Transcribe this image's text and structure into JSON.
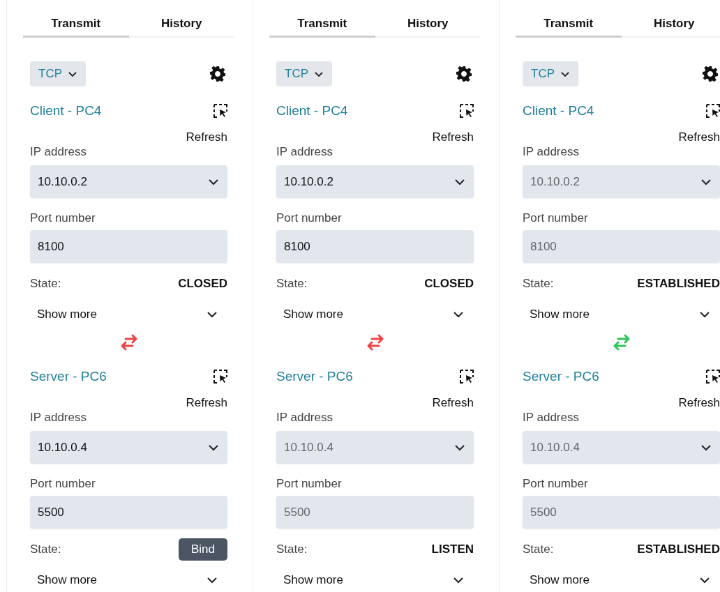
{
  "panels": [
    {
      "tabs": [
        {
          "label": "Transmit",
          "selected": true
        },
        {
          "label": "History",
          "selected": false
        }
      ],
      "protocol": "TCP",
      "connected": false,
      "endpoints": [
        {
          "title": "Client - PC4",
          "refresh": "Refresh",
          "ip_label": "IP address",
          "ip_value": "10.10.0.2",
          "ip_disabled": false,
          "port_label": "Port number",
          "port_value": "8100",
          "port_disabled": false,
          "state_label": "State:",
          "state": {
            "kind": "text",
            "text": "CLOSED"
          },
          "show_more": "Show more"
        },
        {
          "title": "Server - PC6",
          "refresh": "Refresh",
          "ip_label": "IP address",
          "ip_value": "10.10.0.4",
          "ip_disabled": false,
          "port_label": "Port number",
          "port_value": "5500",
          "port_disabled": false,
          "state_label": "State:",
          "state": {
            "kind": "button",
            "text": "Bind"
          },
          "show_more": "Show more"
        }
      ]
    },
    {
      "tabs": [
        {
          "label": "Transmit",
          "selected": true
        },
        {
          "label": "History",
          "selected": false
        }
      ],
      "protocol": "TCP",
      "connected": false,
      "endpoints": [
        {
          "title": "Client - PC4",
          "refresh": "Refresh",
          "ip_label": "IP address",
          "ip_value": "10.10.0.2",
          "ip_disabled": false,
          "port_label": "Port number",
          "port_value": "8100",
          "port_disabled": false,
          "state_label": "State:",
          "state": {
            "kind": "text",
            "text": "CLOSED"
          },
          "show_more": "Show more"
        },
        {
          "title": "Server - PC6",
          "refresh": "Refresh",
          "ip_label": "IP address",
          "ip_value": "10.10.0.4",
          "ip_disabled": true,
          "port_label": "Port number",
          "port_value": "5500",
          "port_disabled": true,
          "state_label": "State:",
          "state": {
            "kind": "text",
            "text": "LISTEN"
          },
          "show_more": "Show more"
        }
      ]
    },
    {
      "tabs": [
        {
          "label": "Transmit",
          "selected": true
        },
        {
          "label": "History",
          "selected": false
        }
      ],
      "protocol": "TCP",
      "connected": true,
      "endpoints": [
        {
          "title": "Client - PC4",
          "refresh": "Refresh",
          "ip_label": "IP address",
          "ip_value": "10.10.0.2",
          "ip_disabled": true,
          "port_label": "Port number",
          "port_value": "8100",
          "port_disabled": true,
          "state_label": "State:",
          "state": {
            "kind": "text",
            "text": "ESTABLISHED"
          },
          "show_more": "Show more"
        },
        {
          "title": "Server - PC6",
          "refresh": "Refresh",
          "ip_label": "IP address",
          "ip_value": "10.10.0.4",
          "ip_disabled": true,
          "port_label": "Port number",
          "port_value": "5500",
          "port_disabled": true,
          "state_label": "State:",
          "state": {
            "kind": "text",
            "text": "ESTABLISHED"
          },
          "show_more": "Show more"
        }
      ]
    }
  ]
}
